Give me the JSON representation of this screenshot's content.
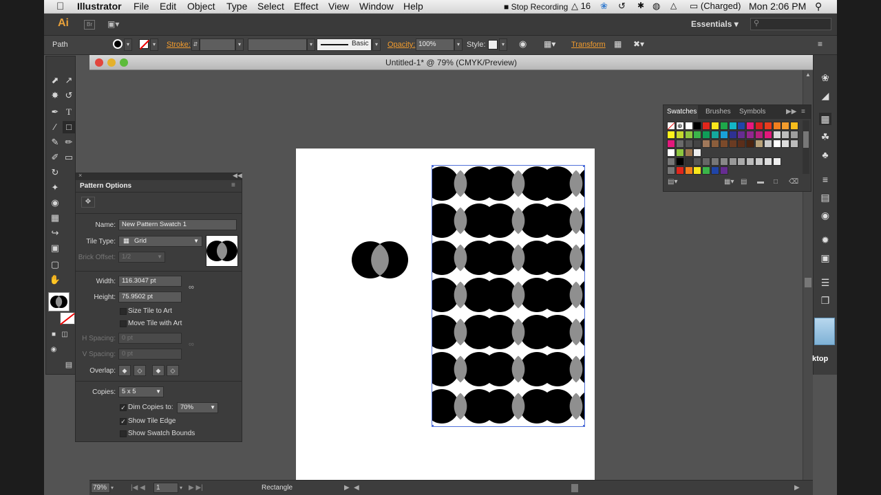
{
  "menubar": {
    "app": "Illustrator",
    "items": [
      "File",
      "Edit",
      "Object",
      "Type",
      "Select",
      "Effect",
      "View",
      "Window",
      "Help"
    ],
    "stop_recording": "Stop Recording",
    "adobe_count": "16",
    "battery": "(Charged)",
    "clock": "Mon 2:06 PM"
  },
  "appbar": {
    "logo": "Ai",
    "br": "Br",
    "workspace": "Essentials"
  },
  "control": {
    "selection": "Path",
    "stroke_label": "Stroke:",
    "stroke_style": "Basic",
    "opacity_label": "Opacity:",
    "opacity_value": "100%",
    "style_label": "Style:",
    "transform_label": "Transform"
  },
  "document": {
    "title": "Untitled-1* @ 79% (CMYK/Preview)"
  },
  "statusbar": {
    "zoom": "79%",
    "artboard": "1",
    "tool": "Rectangle"
  },
  "swatches": {
    "tabs": [
      "Swatches",
      "Brushes",
      "Symbols"
    ]
  },
  "pattern_options": {
    "title": "Pattern Options",
    "name_label": "Name:",
    "name_value": "New Pattern Swatch 1",
    "tile_type_label": "Tile Type:",
    "tile_type_value": "Grid",
    "brick_offset_label": "Brick Offset:",
    "brick_offset_value": "1/2",
    "width_label": "Width:",
    "width_value": "116.3047 pt",
    "height_label": "Height:",
    "height_value": "75.9502 pt",
    "size_tile_label": "Size Tile to Art",
    "move_tile_label": "Move Tile with Art",
    "hspacing_label": "H Spacing:",
    "hspacing_value": "0 pt",
    "vspacing_label": "V Spacing:",
    "vspacing_value": "0 pt",
    "overlap_label": "Overlap:",
    "copies_label": "Copies:",
    "copies_value": "5 x 5",
    "dim_label": "Dim Copies to:",
    "dim_value": "70%",
    "show_tile_edge_label": "Show Tile Edge",
    "show_swatch_bounds_label": "Show Swatch Bounds"
  },
  "desktop_label": "ktop",
  "colors": {
    "pattern_black": "#000000",
    "pattern_gray": "#8f8f8f",
    "accent": "#f39c2d"
  }
}
